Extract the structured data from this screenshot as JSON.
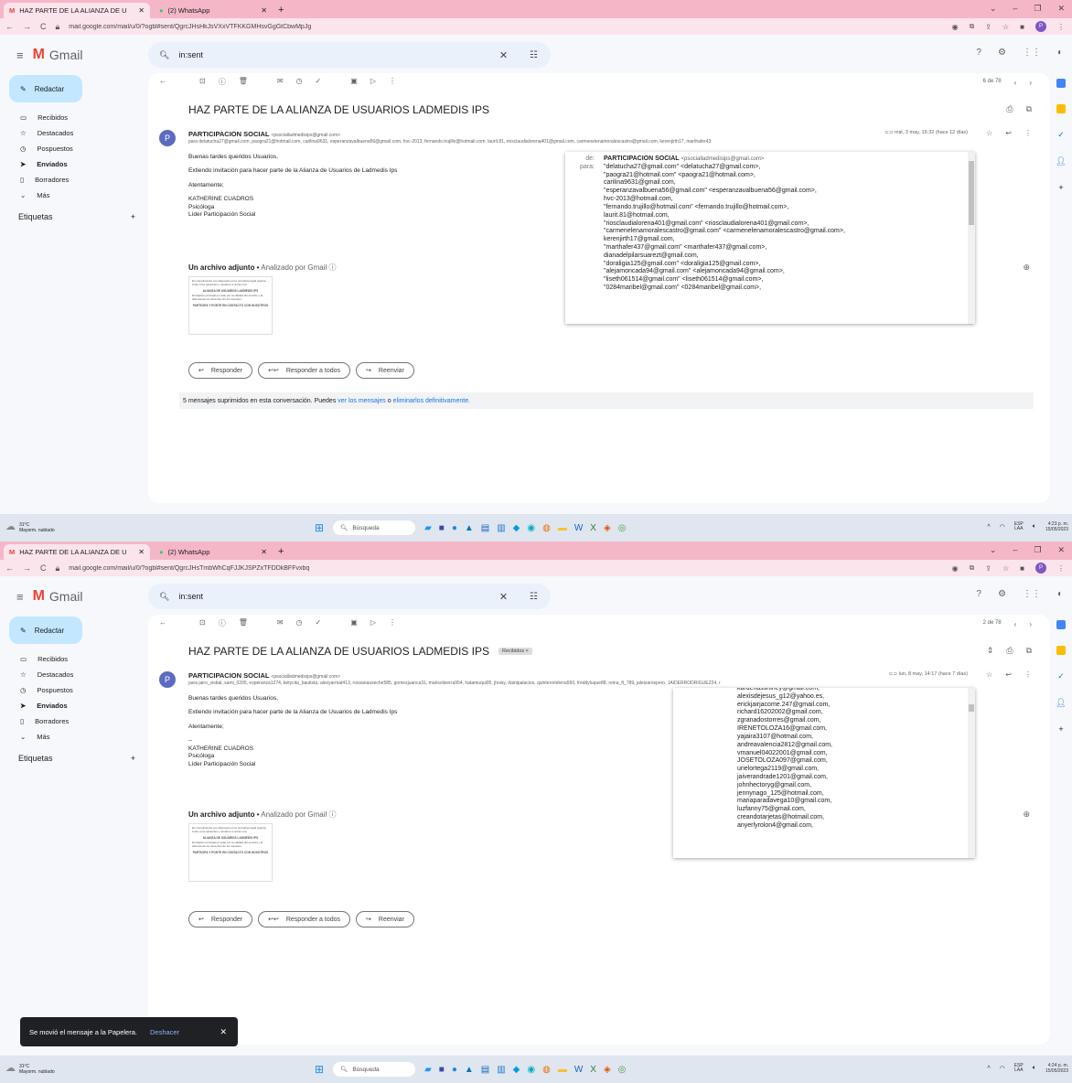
{
  "shot1": {
    "tabs": [
      {
        "title": "HAZ PARTE DE LA ALIANZA DE U",
        "favicon": "gmail-icon"
      },
      {
        "title": "(2) WhatsApp",
        "favicon": "whatsapp-icon"
      }
    ],
    "url": "mail.google.com/mail/u/0/?ogbl#sent/QgrcJHsHkJsVXxVTFKKGMHsvGgGtCbwMpJg",
    "search_query": "in:sent",
    "compose_label": "Redactar",
    "nav": [
      {
        "label": "Recibidos",
        "icon": "inbox-icon"
      },
      {
        "label": "Destacados",
        "icon": "star-icon"
      },
      {
        "label": "Pospuestos",
        "icon": "clock-icon"
      },
      {
        "label": "Enviados",
        "icon": "send-icon"
      },
      {
        "label": "Borradores",
        "icon": "draft-icon"
      },
      {
        "label": "Más",
        "icon": "chevron-down-icon"
      }
    ],
    "labels_title": "Etiquetas",
    "pager": "6 de 78",
    "subject": "HAZ PARTE DE LA ALIANZA DE USUARIOS LADMEDIS IPS",
    "sender_name": "PARTICIPACION SOCIAL",
    "sender_email": "<psocialladmedisips@gmail.com>",
    "recipients": "para delatucha27@gmail.com, paogra21@hotmail.com, carilina9631, esperanzavalbuena56@gmail.com, hvc-2013, fernando.trujillo@hotmail.com, laurit.81, riosclaudialorena401@gmail.com, carmenelenamoralescastro@gmail.com, kerenjirth17, marthafer43",
    "date": "mié, 3 may, 16:32 (hace 12 días)",
    "body": [
      "Buenas tardes queridos Usuarios,",
      "Extiendo invitación para hacer parte de la Alianza de Usuarios de Ladmedis Ips",
      "Atentamente;",
      "KATHERINE CUADROS\nPsicóloga\nLíder Participación Social"
    ],
    "attachment_title": "Un archivo adjunto",
    "attachment_scan": "Analizado por Gmail",
    "thumb_text": "En cumplimiento a lo dispuesto en la normativa legal vigente, invito a los pacientes y usuarios a unirse a la",
    "thumb_title": "ALIANZA DE USUARIOS LADMEDIS IPS",
    "thumb_text2": "El objetivo principal es velar por la calidad del servicio y la defensa de los derechos de los usuarios.",
    "thumb_cta": "PARTICIPA Y PONTE EN CONTACTO CON NOSOTROS",
    "reply": "Responder",
    "reply_all": "Responder a todos",
    "forward": "Reenviar",
    "deleted_note": "5 mensajes suprimidos en esta conversación. Puedes",
    "deleted_link1": "ver los mensajes",
    "deleted_or": "o",
    "deleted_link2": "eliminarlos definitivamente.",
    "popup_de_label": "de:",
    "popup_para_label": "para:",
    "popup_from_name": "PARTICIPACION SOCIAL",
    "popup_from_email": "<psocialladmedisips@gmail.com>",
    "popup_lines": [
      "\"delatucha27@gmail.com\" <delatucha27@gmail.com>,",
      "\"paogra21@hotmail.com\" <paogra21@hotmail.com>,",
      "carilina9631@gmail.com,",
      "\"esperanzavalbuena56@gmail.com\" <esperanzavalbuena56@gmail.com>,",
      "hvc-2013@hotmail.com,",
      "\"fernando.trujillo@hotmail.com\" <fernando.trujillo@hotmail.com>,",
      "laurit.81@hotmail.com,",
      "\"riosclaudialorena401@gmail.com\" <riosclaudialorena401@gmail.com>,",
      "\"carmenelenamoralescastro@gmail.com\" <carmenelenamoralescastro@gmail.com>,",
      "kerenjirth17@gmail.com,",
      "\"marthafer437@gmail.com\" <marthafer437@gmail.com>,",
      "dianadelpilarsuarezt@gmail.com,",
      "\"doraligia125@gmail.com\" <doraligia125@gmail.com>,",
      "\"alejamoncada94@gmail.com\" <alejamoncada94@gmail.com>,",
      "\"liseth061514@gmail.com\" <liseth061514@gmail.com>,",
      "\"0284maribel@gmail.com\" <0284maribel@gmail.com>,"
    ],
    "weather_temp": "31°C",
    "weather_desc": "Mayorm. nublado",
    "taskbar_search": "Búsqueda",
    "lang": "ESP",
    "lang2": "LAA",
    "time": "4:23 p. m.",
    "date_tray": "15/05/2023"
  },
  "shot2": {
    "tabs": [
      {
        "title": "HAZ PARTE DE LA ALIANZA DE U",
        "favicon": "gmail-icon"
      },
      {
        "title": "(2) WhatsApp",
        "favicon": "whatsapp-icon"
      }
    ],
    "url": "mail.google.com/mail/u/0/?ogbl#sent/QgrcJHsTmbWhCqFJJKJSPZxTFDDkBFFvxbq",
    "search_query": "in:sent",
    "compose_label": "Redactar",
    "nav": [
      {
        "label": "Recibidos",
        "icon": "inbox-icon"
      },
      {
        "label": "Destacados",
        "icon": "star-icon"
      },
      {
        "label": "Pospuestos",
        "icon": "clock-icon"
      },
      {
        "label": "Enviados",
        "icon": "send-icon"
      },
      {
        "label": "Borradores",
        "icon": "draft-icon"
      },
      {
        "label": "Más",
        "icon": "chevron-down-icon"
      }
    ],
    "labels_title": "Etiquetas",
    "pager": "2 de 78",
    "subject": "HAZ PARTE DE LA ALIANZA DE USUARIOS LADMEDIS IPS",
    "badge": "Recibidos ×",
    "sender_name": "PARTICIPACION SOCIAL",
    "sender_email": "<psocialladmedisips@gmail.com>",
    "recipients": "para jairo_visbal, sami_0205, esperanza1274, betycita_bautista, alexyarmat413, rossanauseche585, gomezjuanca31, marisolsierra954, hatamuqui05, jhoisy, dainipalacios, quinteromilena550, freddyluque88, reina_ft_789, jaleizarospero, JAIDERRODRIGUEZ24, r",
    "date": "lun, 8 may, 14:17 (hace 7 días)",
    "body": [
      "Buenas tardes queridos Usuarios,",
      "Extiendo invitación para hacer parte de la Alianza de Usuarios de Ladmedis Ips",
      "Atentamente;",
      "--\nKATHERINE CUADROS\nPsicóloga\nLíder Participación Social"
    ],
    "attachment_title": "Un archivo adjunto",
    "attachment_scan": "Analizado por Gmail",
    "thumb_text": "En cumplimiento a lo dispuesto en la normativa legal vigente, invito a los pacientes y usuarios a unirse a la",
    "thumb_title": "ALIANZA DE USUARIOS LADMEDIS IPS",
    "thumb_text2": "El objetivo principal es velar por la calidad del servicio y la defensa de los derechos de los usuarios.",
    "thumb_cta": "PARTICIPA Y PONTE EN CONTACTO CON NOSOTROS",
    "reply": "Responder",
    "reply_all": "Responder a todos",
    "forward": "Reenviar",
    "popup_lines": [
      "kardenasshirley@gmail.com,",
      "alexisdejesus_g12@yahoo.es,",
      "erickjairjacome.247@gmail.com,",
      "richard16202002@gmail.com,",
      "zgranadostorres@gmail.com,",
      "IRENETOLOZA16@gmail.com,",
      "yajaira3107@hotmail.com,",
      "andreavalencia2812@gmail.com,",
      "vmanuel04022001@gmail.com,",
      "JOSETOLOZA097@gmail.com,",
      "urielortega2119@gmail.com,",
      "jaiverandrade1201@gmail.com,",
      "johnhectoryg@gmail.com,",
      "jennynago_125@hotmail.com,",
      "mariaparadavega10@gmail.com,",
      "luzfanny75@gmail.com,",
      "creandotarjetas@hotmail.com,",
      "anyerlyrolon4@gmail.com,"
    ],
    "toast_text": "Se movió el mensaje a la Papelera.",
    "toast_undo": "Deshacer",
    "weather_temp": "31°C",
    "weather_desc": "Mayorm. nublado",
    "taskbar_search": "Búsqueda",
    "lang": "ESP",
    "lang2": "LAA",
    "time": "4:24 p. m.",
    "date_tray": "15/05/2023"
  },
  "colors": {
    "gmail_red": "#ea4335",
    "compose_bg": "#c2e7ff",
    "link": "#1a73e8",
    "tabbar": "#f5b7c8"
  }
}
